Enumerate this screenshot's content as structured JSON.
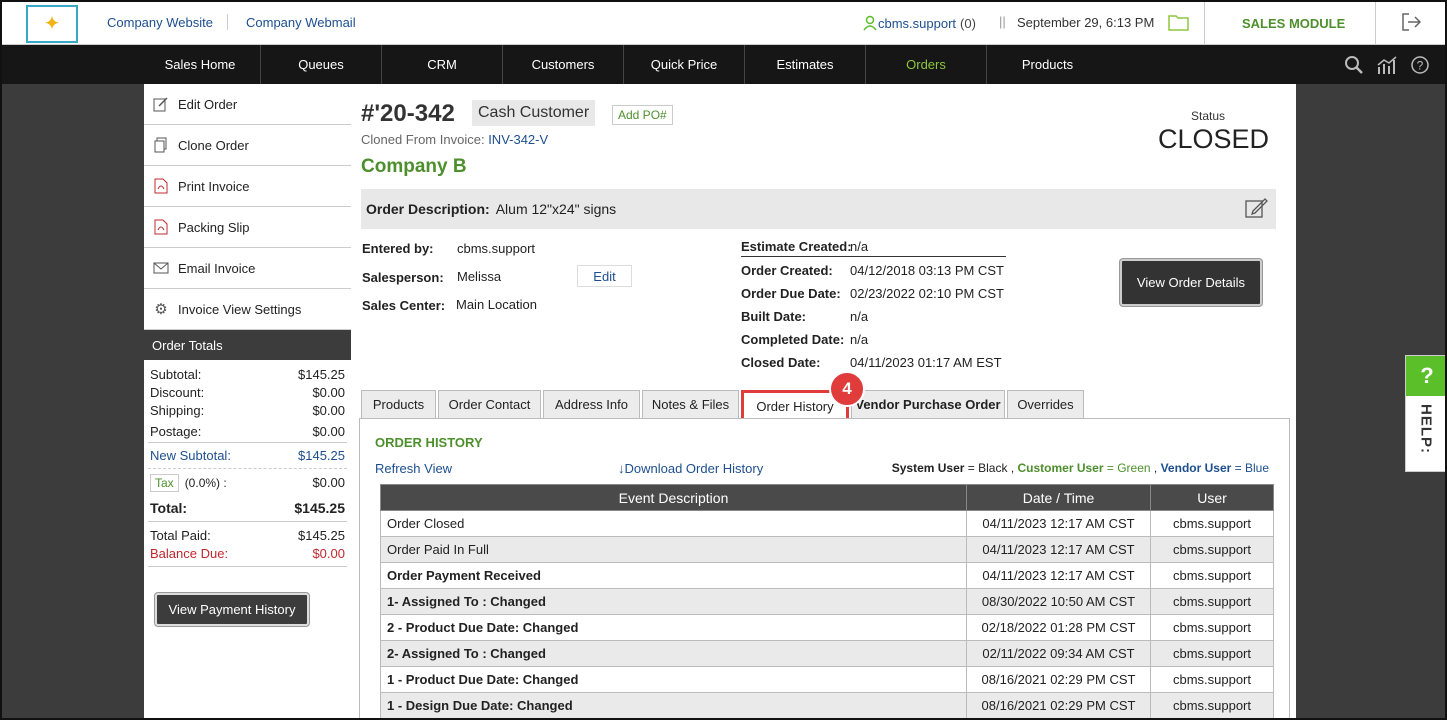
{
  "header": {
    "company_website": "Company Website",
    "company_webmail": "Company Webmail",
    "username": "cbms.support",
    "notif_count": "(0)",
    "separator": "||",
    "datetime": "September 29, 6:13 PM",
    "module": "SALES MODULE"
  },
  "nav": {
    "items": [
      "Sales Home",
      "Queues",
      "CRM",
      "Customers",
      "Quick Price",
      "Estimates",
      "Orders",
      "Products"
    ],
    "active": "Orders"
  },
  "actions": {
    "edit_order": "Edit Order",
    "clone_order": "Clone Order",
    "print_invoice": "Print Invoice",
    "packing_slip": "Packing Slip",
    "email_invoice": "Email Invoice",
    "invoice_view_settings": "Invoice View Settings"
  },
  "totals": {
    "title": "Order Totals",
    "subtotal_label": "Subtotal:",
    "subtotal": "$145.25",
    "discount_label": "Discount:",
    "discount": "$0.00",
    "shipping_label": "Shipping:",
    "shipping": "$0.00",
    "postage_label": "Postage:",
    "postage": "$0.00",
    "new_subtotal_label": "New Subtotal:",
    "new_subtotal": "$145.25",
    "tax_label": "Tax",
    "tax_rate": "(0.0%) :",
    "tax": "$0.00",
    "total_label": "Total:",
    "total": "$145.25",
    "total_paid_label": "Total Paid:",
    "total_paid": "$145.25",
    "balance_due_label": "Balance Due:",
    "balance_due": "$0.00",
    "payment_history_button": "View Payment History"
  },
  "order": {
    "number": "#'20-342",
    "customer_type": "Cash Customer",
    "add_po": "Add PO#",
    "cloned_from_label": "Cloned From Invoice:",
    "cloned_from": "INV-342-V",
    "company": "Company B",
    "status_label": "Status",
    "status": "CLOSED",
    "description_label": "Order Description:",
    "description": "Alum 12\"x24\" signs",
    "entered_by_label": "Entered by:",
    "entered_by": "cbms.support",
    "salesperson_label": "Salesperson:",
    "salesperson": "Melissa",
    "edit_label": "Edit",
    "sales_center_label": "Sales Center:",
    "sales_center": "Main Location",
    "estimate_created_label": "Estimate Created:",
    "estimate_created": "n/a",
    "order_created_label": "Order Created:",
    "order_created": "04/12/2018 03:13 PM CST",
    "order_due_label": "Order Due Date:",
    "order_due": "02/23/2022 02:10 PM CST",
    "built_date_label": "Built Date:",
    "built_date": "n/a",
    "completed_date_label": "Completed Date:",
    "completed_date": "n/a",
    "closed_date_label": "Closed Date:",
    "closed_date": "04/11/2023 01:17 AM EST",
    "view_details_button": "View Order Details"
  },
  "tabs": [
    "Products",
    "Order Contact",
    "Address Info",
    "Notes & Files",
    "Order History",
    "Vendor Purchase Order",
    "Overrides"
  ],
  "step_badge": "4",
  "history": {
    "title": "ORDER HISTORY",
    "refresh": "Refresh View",
    "download": "Download Order History",
    "legend_system": "System User",
    "legend_system_val": "= Black",
    "legend_customer": "Customer User",
    "legend_customer_val": "= Green",
    "legend_vendor": "Vendor User",
    "legend_vendor_val": "= Blue",
    "columns": [
      "Event Description",
      "Date / Time",
      "User"
    ],
    "rows": [
      {
        "event": "Order Closed",
        "date": "04/11/2023 12:17 AM CST",
        "user": "cbms.support",
        "bold": false
      },
      {
        "event": "Order Paid In Full",
        "date": "04/11/2023 12:17 AM CST",
        "user": "cbms.support",
        "bold": false
      },
      {
        "event": "Order Payment Received",
        "date": "04/11/2023 12:17 AM CST",
        "user": "cbms.support",
        "bold": true
      },
      {
        "event": "1- Assigned To : Changed",
        "date": "08/30/2022 10:50 AM CST",
        "user": "cbms.support",
        "bold": true
      },
      {
        "event": "2 - Product Due Date: Changed",
        "date": "02/18/2022 01:28 PM CST",
        "user": "cbms.support",
        "bold": true
      },
      {
        "event": "2- Assigned To : Changed",
        "date": "02/11/2022 09:34 AM CST",
        "user": "cbms.support",
        "bold": true
      },
      {
        "event": "1 - Product Due Date: Changed",
        "date": "08/16/2021 02:29 PM CST",
        "user": "cbms.support",
        "bold": true
      },
      {
        "event": "1 - Design Due Date: Changed",
        "date": "08/16/2021 02:29 PM CST",
        "user": "cbms.support",
        "bold": true
      }
    ]
  },
  "help": {
    "q": "?",
    "label": "HELP:"
  },
  "colors": {
    "accent_green": "#4e8f2d",
    "link_blue": "#1d4f8f",
    "highlight_red": "#e03c3c"
  }
}
